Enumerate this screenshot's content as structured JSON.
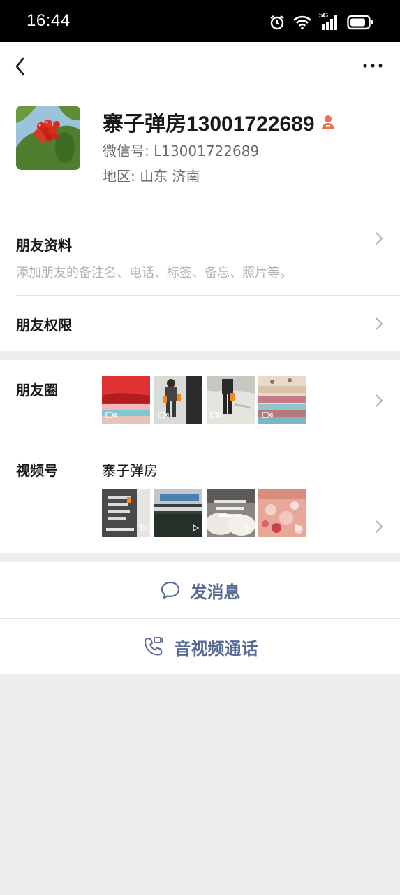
{
  "status_bar": {
    "time": "16:44",
    "network": "5G"
  },
  "profile": {
    "name": "寨子弹房13001722689",
    "wechat_id": "微信号:  L13001722689",
    "region": "地区:  山东  济南"
  },
  "friend_info": {
    "title": "朋友资料",
    "subtitle": "添加朋友的备注名、电话、标签、备忘、照片等。"
  },
  "friend_permission": {
    "title": "朋友权限"
  },
  "moments": {
    "title": "朋友圈",
    "thumbs": [
      "video-thumb-red-quilts",
      "video-thumb-workers",
      "video-thumb-cotton",
      "video-thumb-pink-quilts"
    ]
  },
  "channels": {
    "title": "视频号",
    "account": "寨子弹房",
    "thumbs": [
      "channel-thumb-1",
      "channel-thumb-2",
      "channel-thumb-3",
      "channel-thumb-4"
    ]
  },
  "actions": {
    "message": "发消息",
    "call": "音视频通话"
  },
  "colors": {
    "accent": "#576b95",
    "badge": "#f06c52"
  }
}
